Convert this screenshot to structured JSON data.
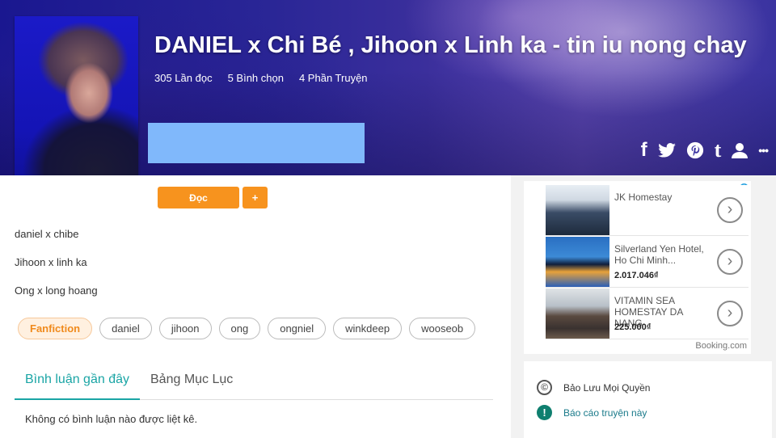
{
  "story": {
    "title": "DANIEL x Chi Bé , Jihoon x Linh ka - tin iu nong chay",
    "reads": "305 Lần đọc",
    "votes": "5 Bình chọn",
    "parts": "4 Phần Truyện"
  },
  "actions": {
    "read_label": "Đọc",
    "add_label": "+"
  },
  "social_icons": [
    "facebook-icon",
    "twitter-icon",
    "pinterest-icon",
    "tumblr-icon",
    "user-icon",
    "more-icon"
  ],
  "social": {
    "facebook": "f",
    "tumblr": "t",
    "more": "•••"
  },
  "description": [
    "daniel x chibe",
    "Jihoon x linh ka",
    "Ong x long hoang"
  ],
  "tags": [
    "Fanfiction",
    "daniel",
    "jihoon",
    "ong",
    "ongniel",
    "winkdeep",
    "wooseob"
  ],
  "tabs": [
    "Bình luận gần đây",
    "Bảng Mục Lục"
  ],
  "comments_empty": "Không có bình luận nào được liệt kê.",
  "ad": {
    "items": [
      {
        "name": "JK Homestay",
        "price": ""
      },
      {
        "name": "Silverland Yen Hotel, Ho Chi Minh...",
        "price": "2.017.046₫"
      },
      {
        "name": "VITAMIN SEA HOMESTAY DA NANG",
        "price": "225.000₫"
      }
    ],
    "brand": "Booking.com",
    "info": "i",
    "arrow": "›"
  },
  "sidebar": {
    "copyright": "Bảo Lưu Mọi Quyền",
    "copyright_symbol": "©",
    "report": "Báo cáo truyện này",
    "report_symbol": "!"
  },
  "colors": {
    "accent_orange": "#f7931e",
    "teal": "#1aa5a5",
    "hero_blue": "#2a2696",
    "placeholder_blue": "#80b8fb"
  }
}
